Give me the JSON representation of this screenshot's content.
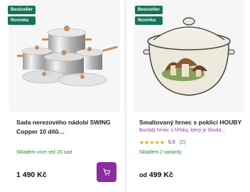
{
  "products": [
    {
      "badges": [
        "Bestseller",
        "Novinka"
      ],
      "title": "Sada nerezového nádobí SWING Copper 10 dílů…",
      "stock": "Skladem více než 20 sad",
      "price": "1 490 Kč",
      "image": "stainless-cookware-set"
    },
    {
      "badges": [
        "Bestseller",
        "Novinka"
      ],
      "title": "Smaltovaný hrnec s poklicí HOUBY",
      "subtitle": "Buclatý hrnec s hříbky, který je škoda...",
      "rating": "5,0",
      "review_count": "(2)",
      "stars": "★★★★★",
      "stock": "Skladem 2 varianty",
      "price_prefix": "od",
      "price": "499 Kč",
      "image": "enamel-pot-mushrooms"
    }
  ],
  "colors": {
    "badge": "#16735a",
    "cart": "#8a2d9e",
    "stock": "#1d8a2a",
    "subtitle": "#8e3fa3",
    "stars": "#e7a600"
  },
  "icons": {
    "cart": "cart-icon"
  }
}
